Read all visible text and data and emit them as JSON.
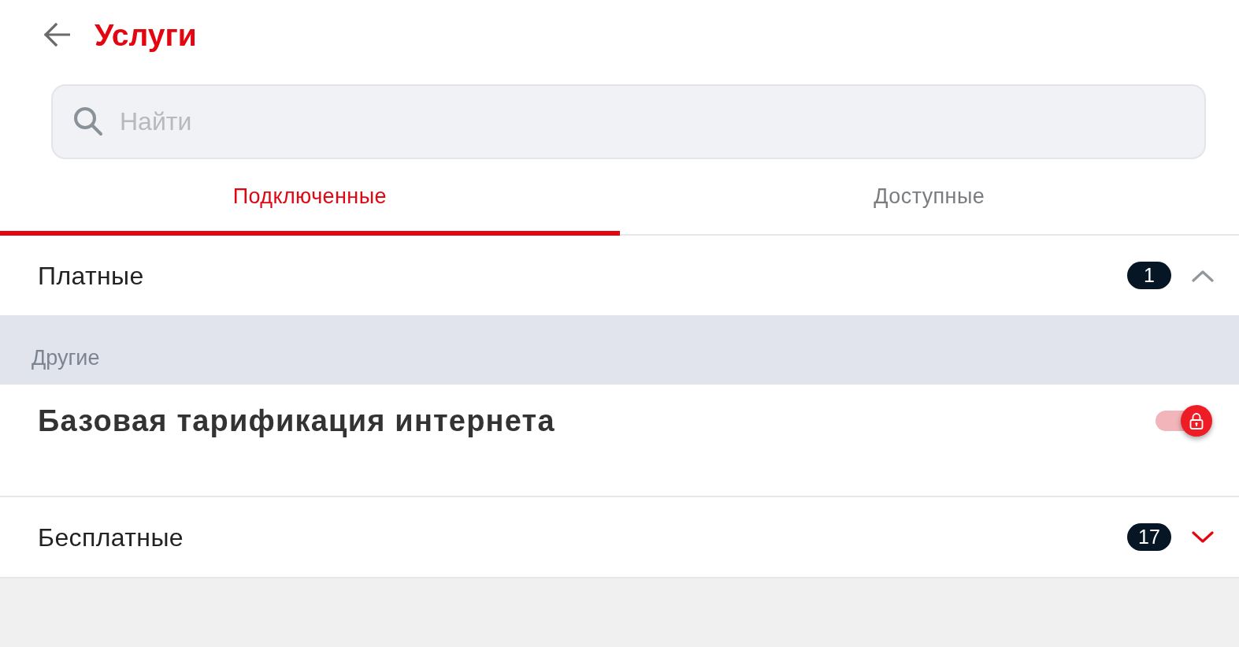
{
  "header": {
    "title": "Услуги"
  },
  "search": {
    "placeholder": "Найти"
  },
  "tabs": [
    {
      "label": "Подключенные",
      "selected": true
    },
    {
      "label": "Доступные",
      "selected": false
    }
  ],
  "sections": [
    {
      "title": "Платные",
      "count": "1",
      "expanded": true,
      "groups": [
        {
          "title": "Другие",
          "items": [
            {
              "name": "Базовая тарификация интернета",
              "on": true,
              "locked": true
            }
          ]
        }
      ]
    },
    {
      "title": "Бесплатные",
      "count": "17",
      "expanded": false
    }
  ]
}
